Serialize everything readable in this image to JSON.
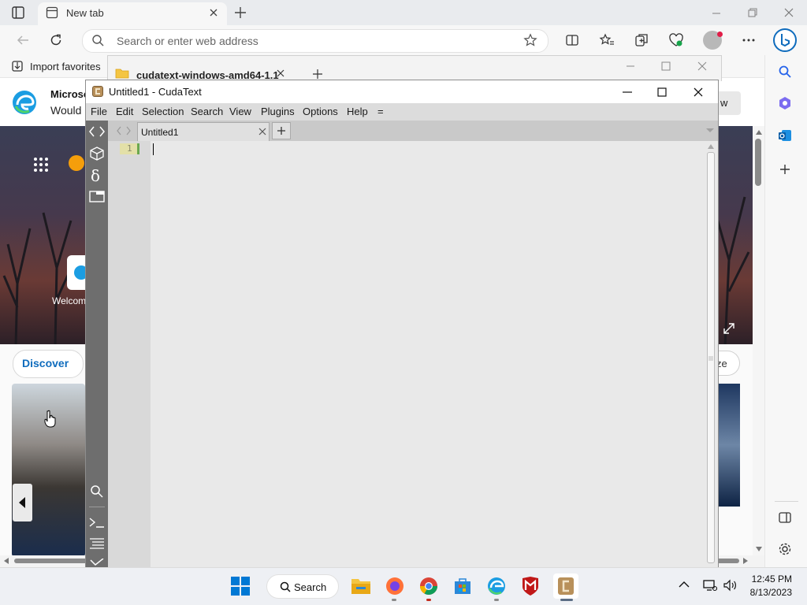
{
  "browser": {
    "tab_title": "New tab",
    "address_placeholder": "Search or enter web address",
    "favorites_import": "Import favorites"
  },
  "ntp": {
    "banner_title": "Microso",
    "banner_subtitle": "Would",
    "banner_button": "w",
    "welcome_label": "Welcom",
    "discover_label": "Discover",
    "personalize_label": "ze"
  },
  "bg_window": {
    "title": "cudatext-windows-amd64-1.1"
  },
  "cudatext": {
    "title": "Untitled1 - CudaText",
    "menu": [
      "File",
      "Edit",
      "Selection",
      "Search",
      "View",
      "Plugins",
      "Options",
      "Help",
      "="
    ],
    "tab_label": "Untitled1",
    "line_number": "1"
  },
  "taskbar": {
    "search_label": "Search",
    "time": "12:45 PM",
    "date": "8/13/2023"
  },
  "colors": {
    "accent": "#0067c0",
    "cuda_side": "#6e6e6e",
    "gutter_highlight": "#e3e0a8"
  }
}
